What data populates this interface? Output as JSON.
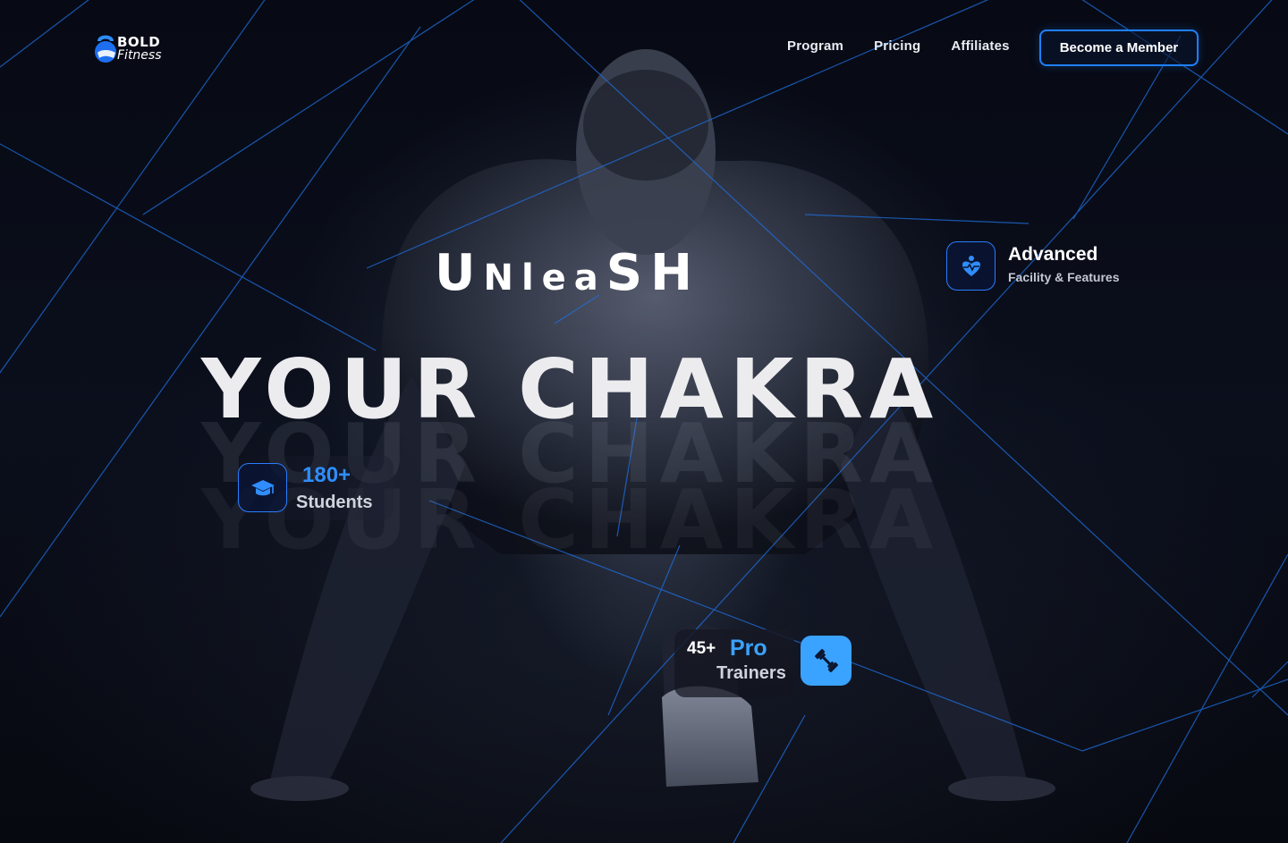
{
  "brand": {
    "name_top": "BOLD",
    "name_bottom": "Fitness",
    "accent_color": "#1e80ff",
    "icon": "kettlebell-icon"
  },
  "nav": {
    "items": [
      {
        "label": "Program"
      },
      {
        "label": "Pricing"
      },
      {
        "label": "Affiliates"
      }
    ],
    "cta_label": "Become a Member"
  },
  "hero": {
    "line1_first": "U",
    "line1_mid": "Nlea",
    "line1_s": "S",
    "line1_last": "H",
    "line2": "YOUR CHAKRA"
  },
  "stats": {
    "facility": {
      "title": "Advanced",
      "subtitle": "Facility & Features",
      "icon": "heart-pulse-person-icon"
    },
    "students": {
      "value": "180+",
      "label": "Students",
      "icon": "graduation-cap-icon"
    },
    "trainers": {
      "value": "45+",
      "highlight": "Pro",
      "label": "Trainers",
      "icon": "dumbbell-icon"
    }
  }
}
